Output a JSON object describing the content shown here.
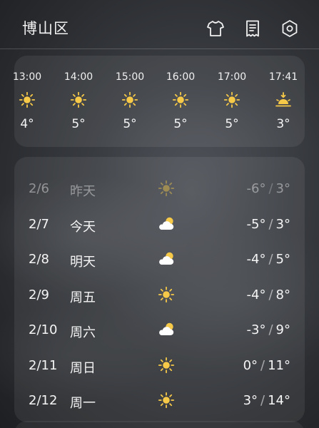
{
  "header": {
    "location": "博山区",
    "icons": [
      "shirt-icon",
      "notes-icon",
      "settings-icon"
    ]
  },
  "colors": {
    "sun": "#f7c948",
    "cloud": "#ffffff",
    "text": "#f5f5f5"
  },
  "hourly": [
    {
      "time": "13:00",
      "icon": "sun-icon",
      "temp": "4°"
    },
    {
      "time": "14:00",
      "icon": "sun-icon",
      "temp": "5°"
    },
    {
      "time": "15:00",
      "icon": "sun-icon",
      "temp": "5°"
    },
    {
      "time": "16:00",
      "icon": "sun-icon",
      "temp": "5°"
    },
    {
      "time": "17:00",
      "icon": "sun-icon",
      "temp": "5°"
    },
    {
      "time": "17:41",
      "icon": "sunset-icon",
      "temp": "3°"
    }
  ],
  "daily": [
    {
      "date": "2/6",
      "name": "昨天",
      "icon": "sun-icon",
      "low": "-6°",
      "sep": "/",
      "high": "3°",
      "past": true
    },
    {
      "date": "2/7",
      "name": "今天",
      "icon": "partly-cloudy-icon",
      "low": "-5°",
      "sep": "/",
      "high": "3°",
      "past": false
    },
    {
      "date": "2/8",
      "name": "明天",
      "icon": "partly-cloudy-icon",
      "low": "-4°",
      "sep": "/",
      "high": "5°",
      "past": false
    },
    {
      "date": "2/9",
      "name": "周五",
      "icon": "sun-icon",
      "low": "-4°",
      "sep": "/",
      "high": "8°",
      "past": false
    },
    {
      "date": "2/10",
      "name": "周六",
      "icon": "partly-cloudy-icon",
      "low": "-3°",
      "sep": "/",
      "high": "9°",
      "past": false
    },
    {
      "date": "2/11",
      "name": "周日",
      "icon": "sun-icon",
      "low": "0°",
      "sep": "/",
      "high": "11°",
      "past": false
    },
    {
      "date": "2/12",
      "name": "周一",
      "icon": "sun-icon",
      "low": "3°",
      "sep": "/",
      "high": "14°",
      "past": false
    }
  ]
}
